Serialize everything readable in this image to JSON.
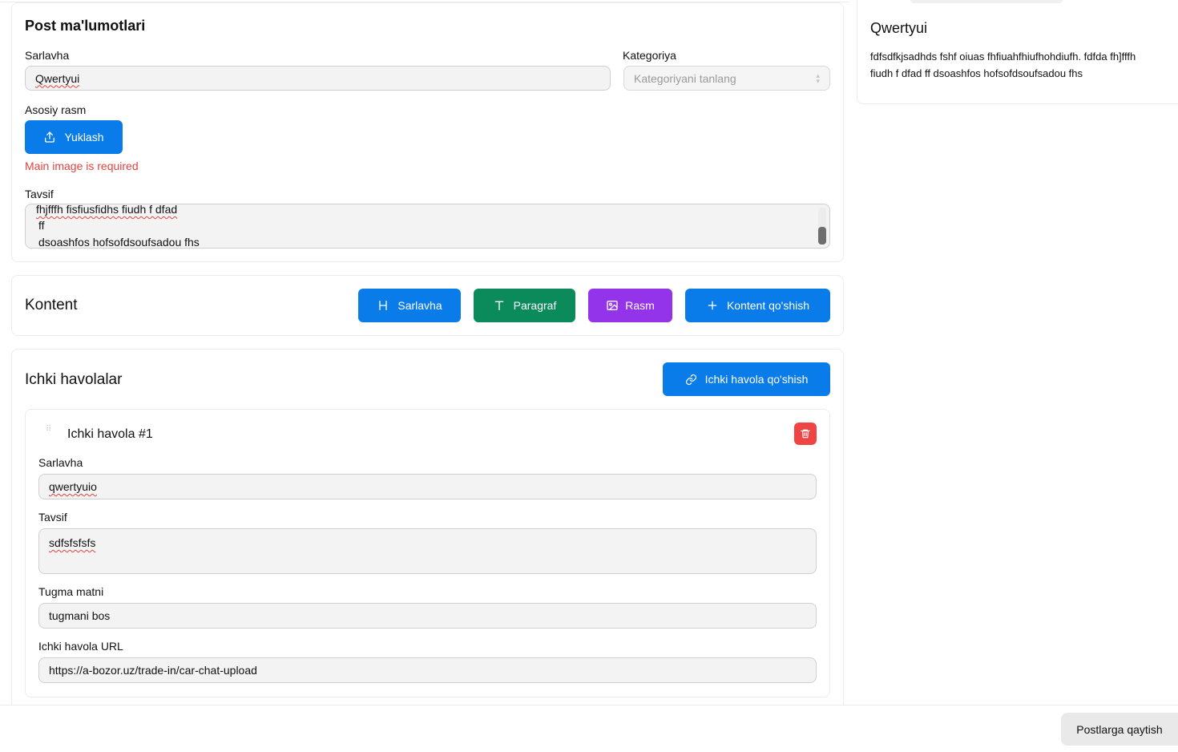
{
  "post_info": {
    "section_title": "Post ma'lumotlari",
    "title_label": "Sarlavha",
    "title_value": "Qwertyui",
    "category_label": "Kategoriya",
    "category_placeholder": "Kategoriyani tanlang",
    "main_image_label": "Asosiy rasm",
    "upload_label": "Yuklash",
    "main_image_error": "Main image is required",
    "description_label": "Tavsif",
    "description_lines": [
      "fhjfffh fisfiusfidhs fiudh f dfad",
      "ff",
      "dsoashfos hofsofdsoufsadou fhs"
    ]
  },
  "content": {
    "section_title": "Kontent",
    "heading_button": "Sarlavha",
    "paragraph_button": "Paragraf",
    "image_button": "Rasm",
    "add_content_button": "Kontent qo'shish"
  },
  "internal_links": {
    "section_title": "Ichki havolalar",
    "add_button": "Ichki havola qo'shish",
    "items": [
      {
        "title": "Ichki havola #1",
        "title_label": "Sarlavha",
        "title_value": "qwertyuio",
        "description_label": "Tavsif",
        "description_value": "sdfsfsfsfs",
        "button_text_label": "Tugma matni",
        "button_text_value": "tugmani bos",
        "url_label": "Ichki havola URL",
        "url_value": "https://a-bozor.uz/trade-in/car-chat-upload"
      }
    ]
  },
  "preview": {
    "title": "Qwertyui",
    "text_line1": "fdfsdfkjsadhds fshf oiuas fhfiuahfhiufhohdiufh. fdfda fh]fffh",
    "text_line2": "fiudh f dfad ff dsoashfos hofsofdsoufsadou fhs"
  },
  "footer": {
    "back_button": "Postlarga qaytish"
  },
  "colors": {
    "primary": "#0a7cea",
    "success": "#0b8a5c",
    "purple": "#9333ea",
    "danger": "#ef4444",
    "error_text": "#e0443e"
  },
  "icons": {
    "upload": "upload-icon",
    "heading": "heading-icon",
    "paragraph": "text-icon",
    "image": "image-icon",
    "plus": "plus-icon",
    "link": "link-icon",
    "trash": "trash-icon",
    "drag": "drag-handle-icon"
  }
}
